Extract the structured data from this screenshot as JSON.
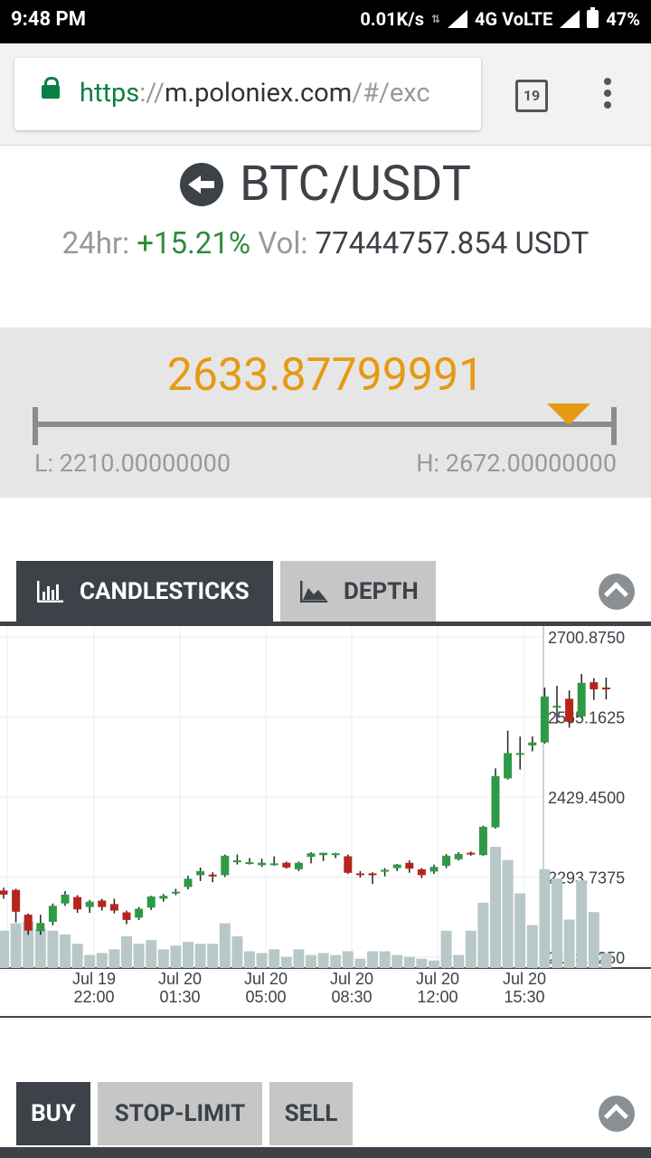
{
  "status_bar": {
    "time": "9:48 PM",
    "net_speed": "0.01K/s",
    "network": "4G VoLTE",
    "battery": "47%"
  },
  "browser": {
    "url_scheme": "https",
    "url_sep": "://",
    "url_host": "m.poloniex.com",
    "url_path": "/#/exc",
    "tab_count": "19"
  },
  "market": {
    "pair": "BTC/USDT",
    "change_label": "24hr:",
    "change_value": "+15.21%",
    "vol_label": "Vol:",
    "vol_value": "77444757.854 USDT",
    "last_price": "2633.87799991",
    "low_label": "L: 2210.00000000",
    "high_label": "H: 2672.00000000",
    "low": 2210.0,
    "high": 2672.0,
    "last": 2633.87799991
  },
  "chart_tabs": {
    "candlesticks": "CANDLESTICKS",
    "depth": "DEPTH"
  },
  "trade_tabs": {
    "buy": "BUY",
    "stop_limit": "STOP-LIMIT",
    "sell": "SELL"
  },
  "colors": {
    "up": "#2e9a45",
    "down": "#b8241c",
    "volume": "#b8c8c9",
    "accent": "#e59a14",
    "dark": "#3c4248"
  },
  "chart_data": {
    "type": "candlestick",
    "y_ticks": [
      "2700.8750",
      "2565.1625",
      "2429.4500",
      "2293.7375",
      "2158.0250"
    ],
    "ylim": [
      2158.025,
      2700.875
    ],
    "x_ticks": [
      {
        "date": "Jul 19",
        "time": "22:00"
      },
      {
        "date": "Jul 20",
        "time": "01:30"
      },
      {
        "date": "Jul 20",
        "time": "05:00"
      },
      {
        "date": "Jul 20",
        "time": "08:30"
      },
      {
        "date": "Jul 20",
        "time": "12:00"
      },
      {
        "date": "Jul 20",
        "time": "15:30"
      }
    ],
    "candles": [
      {
        "o": 2271,
        "c": 2264,
        "h": 2276,
        "l": 2257,
        "v": 0.2
      },
      {
        "o": 2272,
        "c": 2235,
        "h": 2274,
        "l": 2217,
        "v": 0.24
      },
      {
        "o": 2230,
        "c": 2203,
        "h": 2232,
        "l": 2196,
        "v": 0.25
      },
      {
        "o": 2202,
        "c": 2216,
        "h": 2230,
        "l": 2196,
        "v": 0.21
      },
      {
        "o": 2218,
        "c": 2245,
        "h": 2249,
        "l": 2212,
        "v": 0.2
      },
      {
        "o": 2249,
        "c": 2264,
        "h": 2270,
        "l": 2245,
        "v": 0.18
      },
      {
        "o": 2260,
        "c": 2239,
        "h": 2263,
        "l": 2233,
        "v": 0.13
      },
      {
        "o": 2243,
        "c": 2252,
        "h": 2255,
        "l": 2233,
        "v": 0.07
      },
      {
        "o": 2254,
        "c": 2243,
        "h": 2257,
        "l": 2237,
        "v": 0.08
      },
      {
        "o": 2248,
        "c": 2237,
        "h": 2257,
        "l": 2232,
        "v": 0.1
      },
      {
        "o": 2234,
        "c": 2221,
        "h": 2237,
        "l": 2214,
        "v": 0.17
      },
      {
        "o": 2225,
        "c": 2240,
        "h": 2243,
        "l": 2221,
        "v": 0.13
      },
      {
        "o": 2242,
        "c": 2261,
        "h": 2262,
        "l": 2238,
        "v": 0.15
      },
      {
        "o": 2257,
        "c": 2262,
        "h": 2265,
        "l": 2252,
        "v": 0.1
      },
      {
        "o": 2266,
        "c": 2269,
        "h": 2274,
        "l": 2263,
        "v": 0.12
      },
      {
        "o": 2277,
        "c": 2291,
        "h": 2296,
        "l": 2273,
        "v": 0.14
      },
      {
        "o": 2297,
        "c": 2304,
        "h": 2310,
        "l": 2287,
        "v": 0.13
      },
      {
        "o": 2298,
        "c": 2297,
        "h": 2302,
        "l": 2285,
        "v": 0.13
      },
      {
        "o": 2297,
        "c": 2330,
        "h": 2332,
        "l": 2294,
        "v": 0.24
      },
      {
        "o": 2322,
        "c": 2322,
        "h": 2332,
        "l": 2315,
        "v": 0.17
      },
      {
        "o": 2317,
        "c": 2319,
        "h": 2326,
        "l": 2315,
        "v": 0.09
      },
      {
        "o": 2314,
        "c": 2318,
        "h": 2325,
        "l": 2311,
        "v": 0.08
      },
      {
        "o": 2316,
        "c": 2317,
        "h": 2329,
        "l": 2313,
        "v": 0.1
      },
      {
        "o": 2318,
        "c": 2310,
        "h": 2320,
        "l": 2308,
        "v": 0.06
      },
      {
        "o": 2307,
        "c": 2318,
        "h": 2320,
        "l": 2304,
        "v": 0.1
      },
      {
        "o": 2328,
        "c": 2334,
        "h": 2336,
        "l": 2317,
        "v": 0.07
      },
      {
        "o": 2331,
        "c": 2335,
        "h": 2335,
        "l": 2321,
        "v": 0.08
      },
      {
        "o": 2334,
        "c": 2334,
        "h": 2335,
        "l": 2326,
        "v": 0.07
      },
      {
        "o": 2329,
        "c": 2301,
        "h": 2332,
        "l": 2299,
        "v": 0.09
      },
      {
        "o": 2300,
        "c": 2298,
        "h": 2304,
        "l": 2293,
        "v": 0.05
      },
      {
        "o": 2300,
        "c": 2297,
        "h": 2302,
        "l": 2282,
        "v": 0.09
      },
      {
        "o": 2305,
        "c": 2306,
        "h": 2309,
        "l": 2295,
        "v": 0.09
      },
      {
        "o": 2309,
        "c": 2315,
        "h": 2316,
        "l": 2304,
        "v": 0.07
      },
      {
        "o": 2318,
        "c": 2308,
        "h": 2322,
        "l": 2301,
        "v": 0.06
      },
      {
        "o": 2307,
        "c": 2297,
        "h": 2309,
        "l": 2292,
        "v": 0.05
      },
      {
        "o": 2303,
        "c": 2311,
        "h": 2315,
        "l": 2299,
        "v": 0.04
      },
      {
        "o": 2313,
        "c": 2330,
        "h": 2333,
        "l": 2309,
        "v": 0.2
      },
      {
        "o": 2324,
        "c": 2333,
        "h": 2336,
        "l": 2322,
        "v": 0.07
      },
      {
        "o": 2335,
        "c": 2334,
        "h": 2337,
        "l": 2330,
        "v": 0.2
      },
      {
        "o": 2331,
        "c": 2379,
        "h": 2381,
        "l": 2330,
        "v": 0.35
      },
      {
        "o": 2378,
        "c": 2465,
        "h": 2478,
        "l": 2376,
        "v": 0.65
      },
      {
        "o": 2461,
        "c": 2504,
        "h": 2542,
        "l": 2459,
        "v": 0.58
      },
      {
        "o": 2503,
        "c": 2504,
        "h": 2532,
        "l": 2476,
        "v": 0.4
      },
      {
        "o": 2517,
        "c": 2522,
        "h": 2532,
        "l": 2507,
        "v": 0.23
      },
      {
        "o": 2522,
        "c": 2600,
        "h": 2615,
        "l": 2520,
        "v": 0.53
      },
      {
        "o": 2584,
        "c": 2584,
        "h": 2618,
        "l": 2554,
        "v": 0.48
      },
      {
        "o": 2596,
        "c": 2557,
        "h": 2610,
        "l": 2547,
        "v": 0.26
      },
      {
        "o": 2566,
        "c": 2623,
        "h": 2638,
        "l": 2563,
        "v": 0.47
      },
      {
        "o": 2624,
        "c": 2612,
        "h": 2631,
        "l": 2594,
        "v": 0.3
      },
      {
        "o": 2615,
        "c": 2614,
        "h": 2632,
        "l": 2595,
        "v": 0.08
      }
    ]
  }
}
